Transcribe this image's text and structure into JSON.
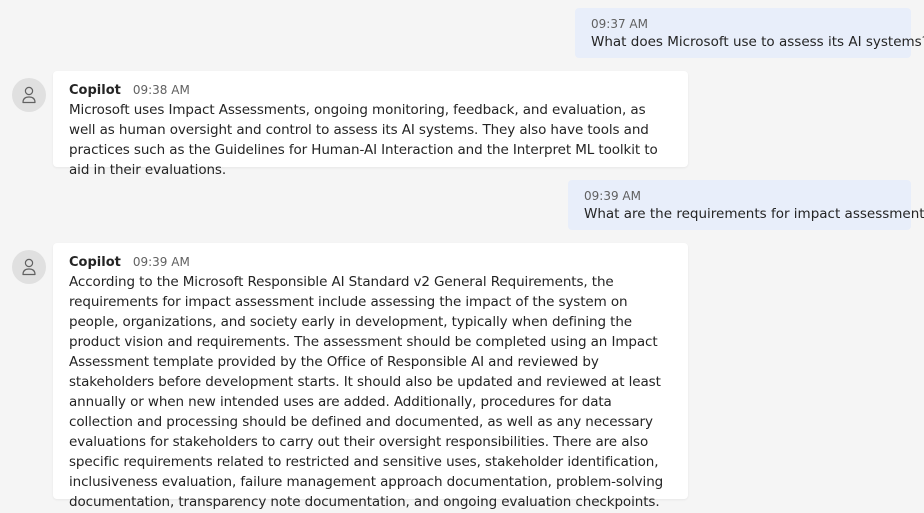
{
  "messages": [
    {
      "role": "user",
      "time": "09:37 AM",
      "text": "What does Microsoft use to assess its AI systems?"
    },
    {
      "role": "assistant",
      "sender": "Copilot",
      "time": "09:38 AM",
      "text": "Microsoft uses Impact Assessments, ongoing monitoring, feedback, and evaluation, as well as human oversight and control to assess its AI systems. They also have tools and practices such as the Guidelines for Human-AI Interaction and the Interpret ML toolkit to aid in their evaluations."
    },
    {
      "role": "user",
      "time": "09:39 AM",
      "text": "What are the requirements for impact assessment?"
    },
    {
      "role": "assistant",
      "sender": "Copilot",
      "time": "09:39 AM",
      "text": "According to the Microsoft Responsible AI Standard v2 General Requirements, the requirements for impact assessment include assessing the impact of the system on people, organizations, and society early in development, typically when defining the product vision and requirements. The assessment should be completed using an Impact Assessment template provided by the Office of Responsible AI and reviewed by stakeholders before development starts. It should also be updated and reviewed at least annually or when new intended uses are added. Additionally, procedures for data collection and processing should be defined and documented, as well as any necessary evaluations for stakeholders to carry out their oversight responsibilities. There are also specific requirements related to restricted and sensitive uses, stakeholder identification, inclusiveness evaluation, failure management approach documentation, problem-solving documentation, transparency note documentation, and ongoing evaluation checkpoints."
    }
  ],
  "icons": {
    "avatar": "bot-person-icon"
  },
  "colors": {
    "background": "#f5f5f5",
    "user_bubble": "#e8eefa",
    "bot_bubble": "#ffffff",
    "avatar_bg": "#e0e0e0"
  }
}
